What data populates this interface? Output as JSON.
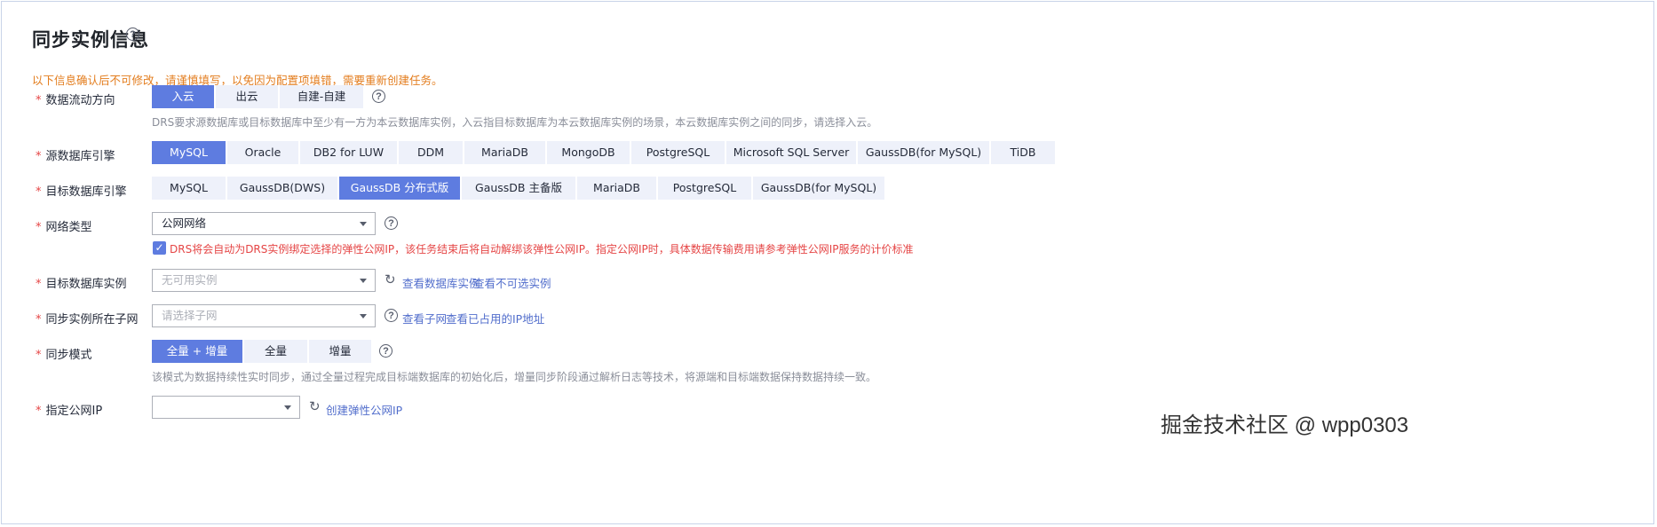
{
  "section": {
    "title": "同步实例信息",
    "help_glyph": "?",
    "warning": "以下信息确认后不可修改，请谨慎填写，以免因为配置项填错，需要重新创建任务。"
  },
  "fields": {
    "direction": {
      "label": "数据流动方向",
      "options": [
        "入云",
        "出云",
        "自建-自建"
      ],
      "selected": "入云",
      "hint": "DRS要求源数据库或目标数据库中至少有一方为本云数据库实例，入云指目标数据库为本云数据库实例的场景，本云数据库实例之间的同步，请选择入云。"
    },
    "source_engine": {
      "label": "源数据库引擎",
      "options": [
        "MySQL",
        "Oracle",
        "DB2 for LUW",
        "DDM",
        "MariaDB",
        "MongoDB",
        "PostgreSQL",
        "Microsoft SQL Server",
        "GaussDB(for MySQL)",
        "TiDB"
      ],
      "selected": "MySQL"
    },
    "target_engine": {
      "label": "目标数据库引擎",
      "options": [
        "MySQL",
        "GaussDB(DWS)",
        "GaussDB 分布式版",
        "GaussDB 主备版",
        "MariaDB",
        "PostgreSQL",
        "GaussDB(for MySQL)"
      ],
      "selected": "GaussDB 分布式版"
    },
    "network_type": {
      "label": "网络类型",
      "value": "公网网络",
      "eip_notice": "DRS将会自动为DRS实例绑定选择的弹性公网IP，该任务结束后将自动解绑该弹性公网IP。指定公网IP时，具体数据传输费用请参考弹性公网IP服务的计价标准",
      "checkbox_checked": true
    },
    "target_instance": {
      "label": "目标数据库实例",
      "placeholder": "无可用实例",
      "links": [
        "查看数据库实例",
        "查看不可选实例"
      ]
    },
    "subnet": {
      "label": "同步实例所在子网",
      "placeholder": "请选择子网",
      "links": [
        "查看子网",
        "查看已占用的IP地址"
      ]
    },
    "sync_mode": {
      "label": "同步模式",
      "options": [
        "全量 + 增量",
        "全量",
        "增量"
      ],
      "selected": "全量 + 增量",
      "hint": "该模式为数据持续性实时同步，通过全量过程完成目标端数据库的初始化后，增量同步阶段通过解析日志等技术，将源端和目标端数据保持数据持续一致。"
    },
    "public_ip": {
      "label": "指定公网IP",
      "value": "",
      "link": "创建弹性公网IP"
    }
  },
  "required_mark": "*",
  "icons": {
    "help": "question-circle-icon",
    "refresh": "refresh-icon",
    "caret": "chevron-down-icon",
    "check": "check-icon"
  },
  "colors": {
    "accent": "#5e7ce0",
    "option_bg": "#eef1fa",
    "warning": "#e37d1e",
    "error": "#e54545",
    "link": "#526ecc"
  },
  "watermark": "掘金技术社区 @ wpp0303"
}
